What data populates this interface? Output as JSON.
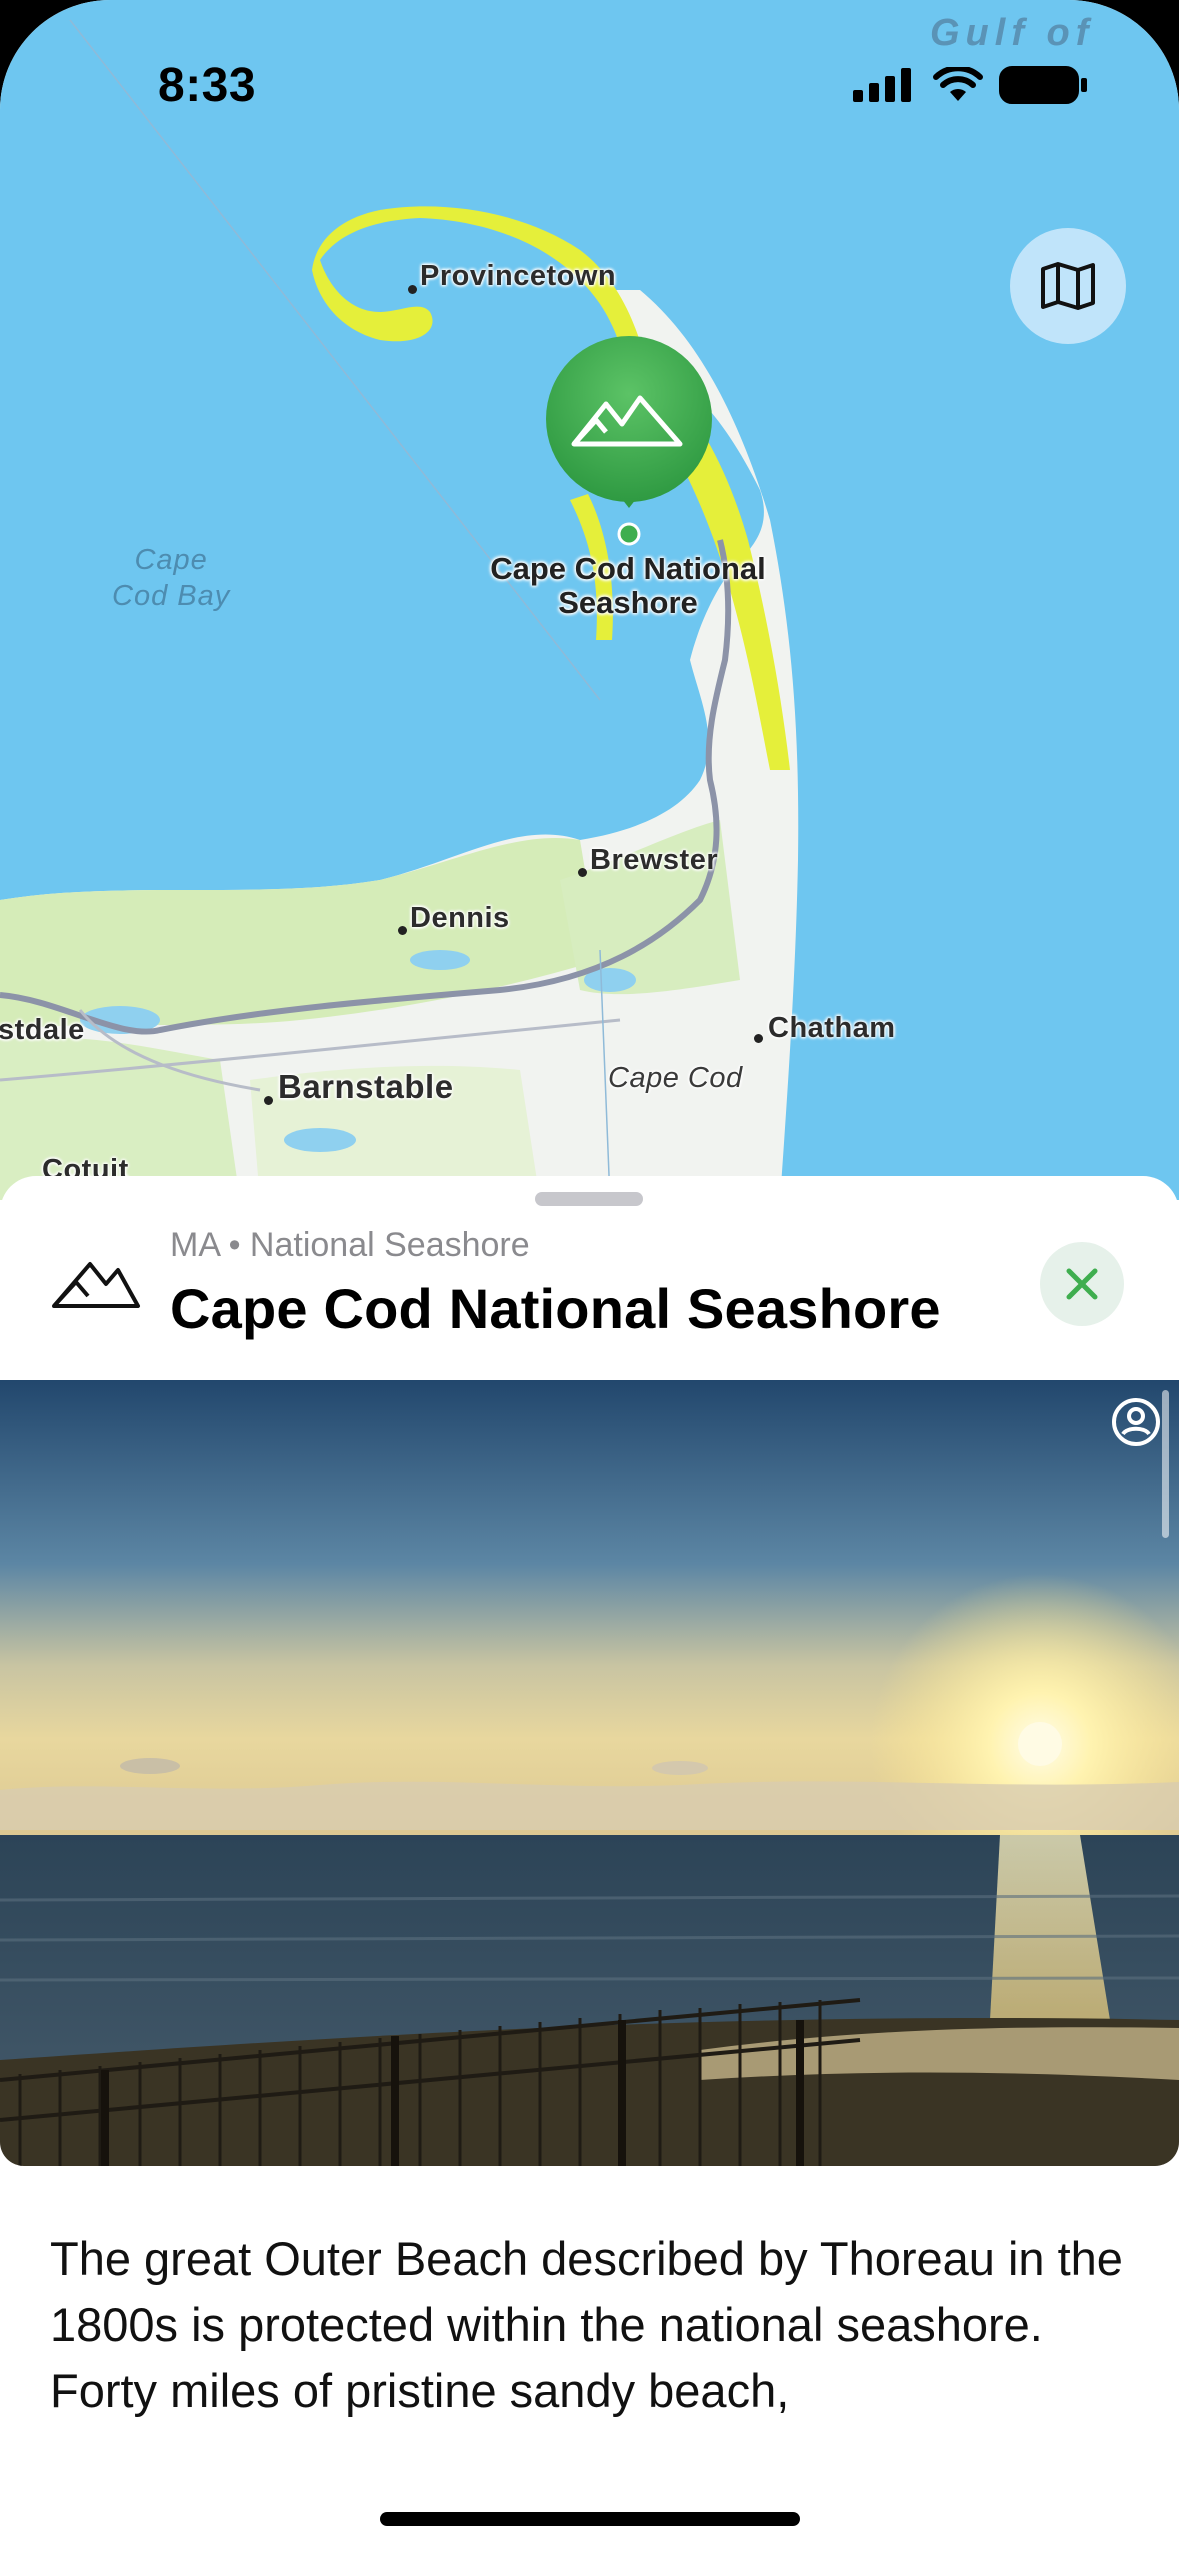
{
  "status_bar": {
    "time": "8:33"
  },
  "map": {
    "labels": {
      "gulf": "Gulf of",
      "provincetown": "Provincetown",
      "cape_cod_bay": "Cape\nCod Bay",
      "brewster": "Brewster",
      "dennis": "Dennis",
      "chatham": "Chatham",
      "barnstable": "Barnstable",
      "cape_cod": "Cape Cod",
      "westdale": "stdale",
      "cotuit": "Cotuit"
    },
    "pin": {
      "title": "Cape Cod National Seashore",
      "icon": "mountains-icon",
      "color": "#3fae4f"
    },
    "map_type_button": {
      "icon": "map-icon"
    }
  },
  "sheet": {
    "subtitle": "MA • National Seashore",
    "title": "Cape Cod National Seashore",
    "close_icon": "close-icon",
    "description": "The great Outer Beach described by Thoreau in the 1800s is protected within the national seashore. Forty miles of pristine sandy beach,"
  },
  "colors": {
    "water": "#6ec6f0",
    "land": "#f1f3f0",
    "park": "#e5ef3a",
    "accent": "#3fae4f"
  }
}
